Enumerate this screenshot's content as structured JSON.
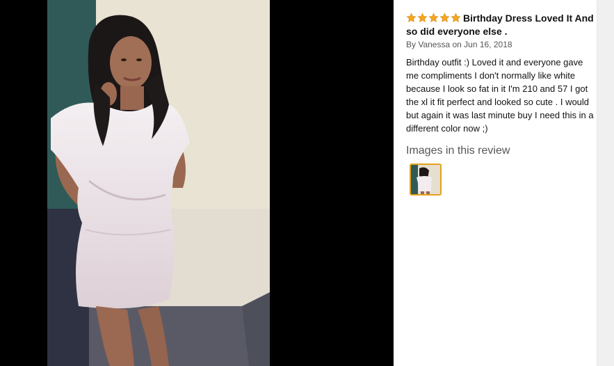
{
  "review": {
    "rating": 5,
    "star_color": "#f5a623",
    "title": "Birthday Dress Loved It And so did everyone else .",
    "byline": "By Vanessa on Jun 16, 2018",
    "body": "Birthday outfit :) Loved it and everyone gave me compliments I don't normally like white because I look so fat in it I'm 210 and 57 I got the xl it fit perfect and looked so cute . I would but again it was last minute buy I need this in a different color now ;)"
  },
  "images_section": {
    "heading": "Images in this review",
    "thumbnail_count": 1,
    "selected_border_color": "#e2a21b"
  }
}
